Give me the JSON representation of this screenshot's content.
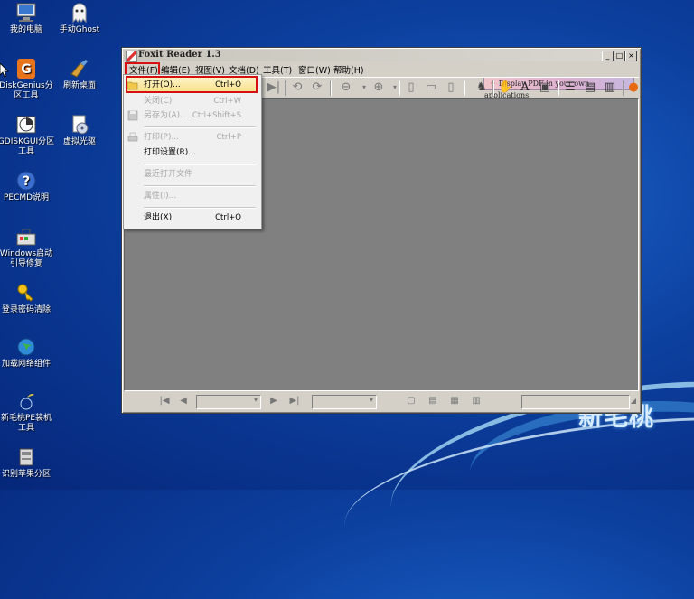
{
  "brand": {
    "text": "新毛桃"
  },
  "desktop_icons": [
    {
      "name": "my-computer",
      "label": "我的电脑"
    },
    {
      "name": "manual-ghost",
      "label": "手动Ghost"
    },
    {
      "name": "diskgenius",
      "label": "DiskGenius分区工具"
    },
    {
      "name": "refresh-desktop",
      "label": "刷新桌面"
    },
    {
      "name": "gdiskgui",
      "label": "GDISKGUI分区工具"
    },
    {
      "name": "virtual-cd",
      "label": "虚拟光驱"
    },
    {
      "name": "pecmd-help",
      "label": "PECMD说明"
    },
    {
      "name": "windows-boot-repair",
      "label": "Windows启动引导修复"
    },
    {
      "name": "password-clear",
      "label": "登录密码清除"
    },
    {
      "name": "network-component",
      "label": "加载网络组件"
    },
    {
      "name": "xinmaotao-pe-installer",
      "label": "新毛桃PE装机工具"
    },
    {
      "name": "partition-tool",
      "label": "识别苹果分区"
    }
  ],
  "window": {
    "title": "Foxit Reader 1.3",
    "controls": {
      "minimize": "_",
      "maximize": "□",
      "close": "×"
    },
    "menu": [
      "文件(F)",
      "编辑(E)",
      "视图(V)",
      "文档(D)",
      "工具(T)",
      "窗口(W)",
      "帮助(H)"
    ],
    "promo": "Display PDF in your own applications"
  },
  "file_menu": {
    "items": [
      {
        "label": "打开(O)...",
        "shortcut": "Ctrl+O",
        "enabled": true,
        "highlighted": true
      },
      {
        "label": "关闭(C)",
        "shortcut": "Ctrl+W",
        "enabled": false
      },
      {
        "label": "另存为(A)...",
        "shortcut": "Ctrl+Shift+S",
        "enabled": false
      },
      {
        "label": "打印(P)...",
        "shortcut": "Ctrl+P",
        "enabled": false
      },
      {
        "label": "打印设置(R)...",
        "shortcut": "",
        "enabled": true
      },
      {
        "label": "最近打开文件",
        "shortcut": "",
        "enabled": false
      },
      {
        "label": "属性(I)...",
        "shortcut": "",
        "enabled": false
      },
      {
        "label": "退出(X)",
        "shortcut": "Ctrl+Q",
        "enabled": true
      }
    ]
  },
  "colors": {
    "highlight_border": "#d41010",
    "workspace": "#808080",
    "desktop": "#0c3f9e"
  }
}
